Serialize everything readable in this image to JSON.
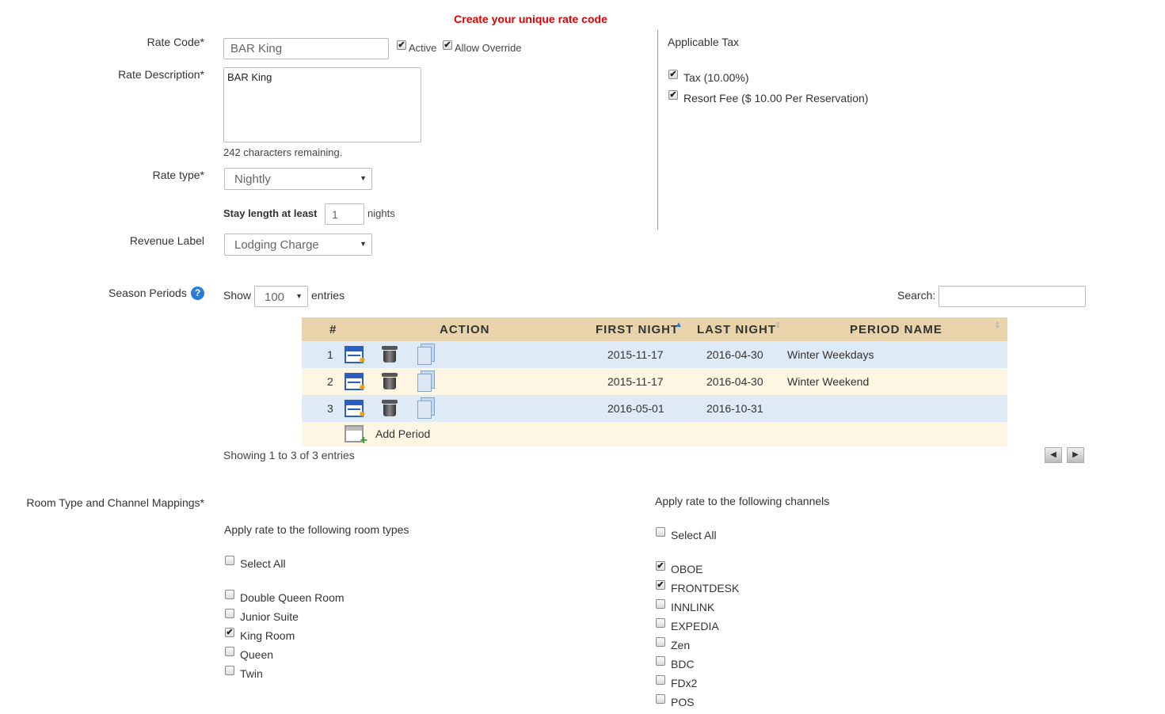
{
  "page_title": "Create your unique rate code",
  "form": {
    "rate_code_label": "Rate Code*",
    "rate_code_value": "BAR King",
    "active_label": "Active",
    "active_checked": true,
    "allow_override_label": "Allow Override",
    "allow_override_checked": true,
    "rate_description_label": "Rate Description*",
    "rate_description_value": "BAR King",
    "chars_remaining": "242 characters remaining.",
    "rate_type_label": "Rate type*",
    "rate_type_value": "Nightly",
    "stay_length_label": "Stay length at least",
    "stay_length_value": "1",
    "stay_length_unit": "nights",
    "revenue_label_label": "Revenue Label",
    "revenue_label_value": "Lodging Charge"
  },
  "tax": {
    "heading": "Applicable Tax",
    "items": [
      {
        "label": "Tax (10.00%)",
        "checked": true
      },
      {
        "label": "Resort Fee ($ 10.00 Per Reservation)",
        "checked": true
      }
    ]
  },
  "season_periods": {
    "label": "Season Periods",
    "help_icon": "?",
    "show_label": "Show",
    "page_size": "100",
    "entries_label": "entries",
    "search_label": "Search:",
    "search_value": "",
    "columns": [
      "#",
      "ACTION",
      "FIRST NIGHT",
      "LAST NIGHT",
      "PERIOD NAME"
    ],
    "rows": [
      {
        "num": "1",
        "first_night": "2015-11-17",
        "last_night": "2016-04-30",
        "name": "Winter Weekdays"
      },
      {
        "num": "2",
        "first_night": "2015-11-17",
        "last_night": "2016-04-30",
        "name": "Winter Weekend"
      },
      {
        "num": "3",
        "first_night": "2016-05-01",
        "last_night": "2016-10-31",
        "name": ""
      }
    ],
    "add_period_label": "Add Period",
    "info": "Showing 1 to 3 of 3 entries",
    "prev_glyph": "◀",
    "next_glyph": "▶"
  },
  "mappings": {
    "label": "Room Type and Channel Mappings*",
    "room_heading": "Apply rate to the following room types",
    "room_select_all": "Select All",
    "room_types": [
      {
        "label": "Double Queen Room",
        "checked": false
      },
      {
        "label": "Junior Suite",
        "checked": false
      },
      {
        "label": "King Room",
        "checked": true
      },
      {
        "label": "Queen",
        "checked": false
      },
      {
        "label": "Twin",
        "checked": false
      }
    ],
    "channel_heading": "Apply rate to the following channels",
    "channel_select_all": "Select All",
    "channels": [
      {
        "label": "OBOE",
        "checked": true
      },
      {
        "label": "FRONTDESK",
        "checked": true
      },
      {
        "label": "INNLINK",
        "checked": false
      },
      {
        "label": "EXPEDIA",
        "checked": false
      },
      {
        "label": "Zen",
        "checked": false
      },
      {
        "label": "BDC",
        "checked": false
      },
      {
        "label": "FDx2",
        "checked": false
      },
      {
        "label": "POS",
        "checked": false
      }
    ]
  },
  "colors": {
    "title_red": "#e00000",
    "table_header": "#e8d3aa",
    "row_blue": "#dfeaf7",
    "row_cream": "#fdf6e3"
  }
}
